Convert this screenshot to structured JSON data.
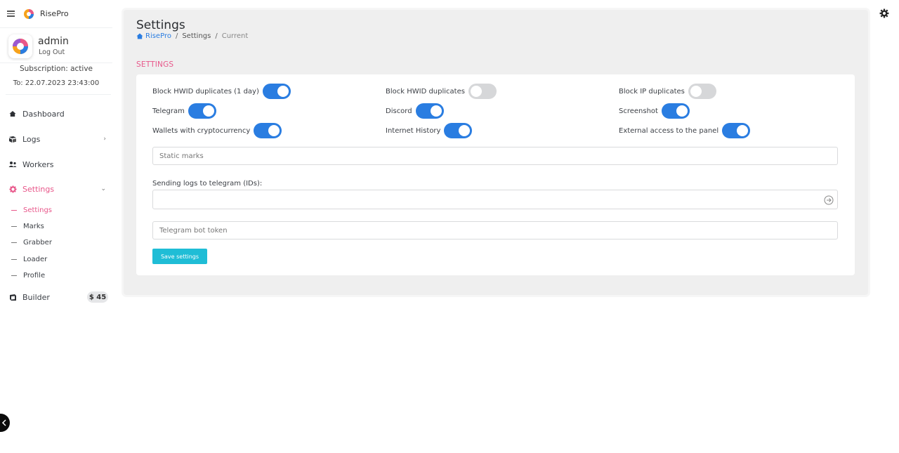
{
  "brand": {
    "name": "RisePro"
  },
  "user": {
    "name": "admin",
    "logout_label": "Log Out"
  },
  "subscription": {
    "status": "Subscription: active",
    "expiry": "To: 22.07.2023 23:43:00"
  },
  "sidebar": {
    "items": [
      {
        "label": "Dashboard",
        "icon": "home-icon"
      },
      {
        "label": "Logs",
        "icon": "logs-icon",
        "chevron": "›"
      },
      {
        "label": "Workers",
        "icon": "workers-icon"
      },
      {
        "label": "Settings",
        "icon": "gear-icon",
        "chevron": "⌄",
        "active": true
      },
      {
        "label": "Builder",
        "icon": "builder-icon",
        "badge": "$ 45"
      }
    ],
    "settings_sub": [
      {
        "label": "Settings",
        "active": true
      },
      {
        "label": "Marks"
      },
      {
        "label": "Grabber"
      },
      {
        "label": "Loader"
      },
      {
        "label": "Profile"
      }
    ]
  },
  "page": {
    "title": "Settings",
    "breadcrumb": [
      "RisePro",
      "Settings",
      "Current"
    ],
    "section": "SETTINGS"
  },
  "options": [
    {
      "label": "Block HWID duplicates (1 day)",
      "on": true
    },
    {
      "label": "Block HWID duplicates",
      "on": false
    },
    {
      "label": "Block IP duplicates",
      "on": false
    },
    {
      "label": "Telegram",
      "on": true
    },
    {
      "label": "Discord",
      "on": true
    },
    {
      "label": "Screenshot",
      "on": true
    },
    {
      "label": "Wallets with cryptocurrency",
      "on": true
    },
    {
      "label": "Internet History",
      "on": true
    },
    {
      "label": "External access to the panel",
      "on": true
    }
  ],
  "fields": {
    "static_marks": {
      "placeholder": "Static marks",
      "value": ""
    },
    "telegram_ids": {
      "label": "Sending logs to telegram (IDs):",
      "value": ""
    },
    "bot_token": {
      "placeholder": "Telegram bot token",
      "value": ""
    }
  },
  "save_label": "Save settings",
  "colors": {
    "accent": "#e8578a",
    "toggle_on": "#2a7de1",
    "button": "#1fbdd6",
    "panel_bg": "#efefef"
  }
}
